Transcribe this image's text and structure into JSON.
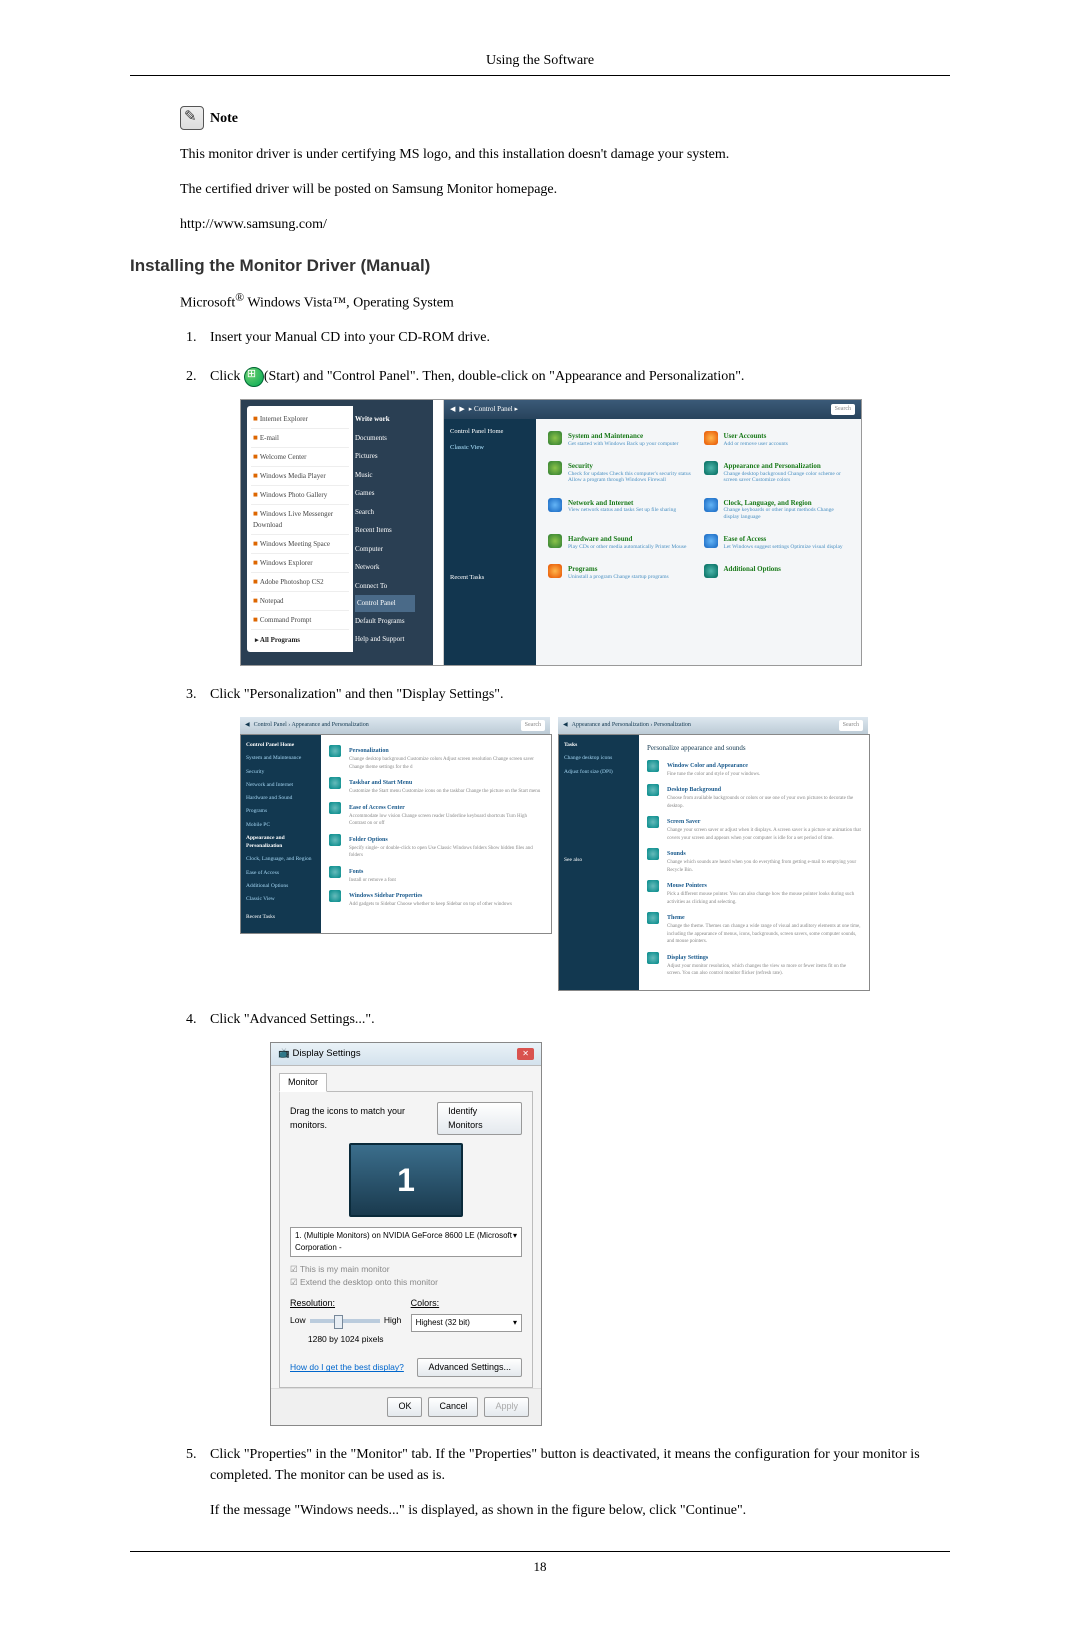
{
  "header": {
    "title": "Using the Software"
  },
  "note": {
    "label": "Note",
    "line1": "This monitor driver is under certifying MS logo, and this installation doesn't damage your system.",
    "line2": "The certified driver will be posted on Samsung Monitor homepage.",
    "line3": "http://www.samsung.com/"
  },
  "section_title": "Installing the Monitor Driver (Manual)",
  "os_line_prefix": "Microsoft",
  "os_line_rest": " Windows Vista™, Operating System",
  "steps": {
    "s1": "Insert your Manual CD into your CD-ROM drive.",
    "s2a": "Click ",
    "s2b": "(Start) and \"Control Panel\". Then, double-click on \"Appearance and Personalization\".",
    "s3": "Click \"Personalization\" and then \"Display Settings\".",
    "s4": "Click \"Advanced Settings...\".",
    "s5": "Click \"Properties\" in the \"Monitor\" tab. If the \"Properties\" button is deactivated, it means the configuration for your monitor is completed. The monitor can be used as is.",
    "s5b": "If the message \"Windows needs...\" is displayed, as shown in the figure below, click \"Continue\"."
  },
  "start_menu": {
    "items": [
      "Internet Explorer",
      "E-mail",
      "Welcome Center",
      "Windows Media Player",
      "Windows Photo Gallery",
      "Windows Live Messenger Download",
      "Windows Meeting Space",
      "Windows Explorer",
      "Adobe Photoshop CS2",
      "Notepad",
      "Command Prompt"
    ],
    "right": [
      "Documents",
      "Pictures",
      "Music",
      "Games",
      "Search",
      "Recent Items",
      "Computer",
      "Network",
      "Connect To",
      "Control Panel",
      "Default Programs",
      "Help and Support"
    ],
    "all_programs": "All Programs",
    "right_top": "Write work"
  },
  "control_panel": {
    "crumb": "Control Panel",
    "search": "Search",
    "left": [
      "Control Panel Home",
      "Classic View"
    ],
    "left_recent": "Recent Tasks",
    "cats": [
      {
        "main": "System and Maintenance",
        "sub": "Get started with Windows\nBack up your computer"
      },
      {
        "main": "User Accounts",
        "sub": "Add or remove user accounts"
      },
      {
        "main": "Security",
        "sub": "Check for updates\nCheck this computer's security status\nAllow a program through Windows Firewall"
      },
      {
        "main": "Appearance and Personalization",
        "sub": "Change desktop background\nChange color scheme or screen saver\nCustomize colors"
      },
      {
        "main": "Network and Internet",
        "sub": "View network status and tasks\nSet up file sharing"
      },
      {
        "main": "Clock, Language, and Region",
        "sub": "Change keyboards or other input methods\nChange display language"
      },
      {
        "main": "Hardware and Sound",
        "sub": "Play CDs or other media automatically\nPrinter\nMouse"
      },
      {
        "main": "Ease of Access",
        "sub": "Let Windows suggest settings\nOptimize visual display"
      },
      {
        "main": "Programs",
        "sub": "Uninstall a program\nChange startup programs"
      },
      {
        "main": "Additional Options",
        "sub": ""
      }
    ]
  },
  "appearance_panel": {
    "crumb_left": "Control Panel › Appearance and Personalization",
    "left_items": [
      "Control Panel Home",
      "System and Maintenance",
      "Security",
      "Network and Internet",
      "Hardware and Sound",
      "Programs",
      "Mobile PC",
      "Appearance and Personalization",
      "Clock, Language, and Region",
      "Ease of Access",
      "Additional Options",
      "Classic View"
    ],
    "rows": [
      {
        "m": "Personalization",
        "s": "Change desktop background   Customize colors   Adjust screen resolution\nChange screen saver  Change theme settings for the d"
      },
      {
        "m": "Taskbar and Start Menu",
        "s": "Customize the Start menu   Customize icons on the taskbar\nChange the picture on the Start menu"
      },
      {
        "m": "Ease of Access Center",
        "s": "Accommodate low vision   Change screen reader\nUnderline keyboard shortcuts   Turn High Contrast on or off"
      },
      {
        "m": "Folder Options",
        "s": "Specify single- or double-click to open   Use Classic Windows folders\nShow hidden files and folders"
      },
      {
        "m": "Fonts",
        "s": "Install or remove a font"
      },
      {
        "m": "Windows Sidebar Properties",
        "s": "Add gadgets to Sidebar   Choose whether to keep Sidebar on top of other windows"
      }
    ],
    "recent": "Recent Tasks"
  },
  "personalization_panel": {
    "crumb": "Appearance and Personalization › Personalization",
    "tasks_label": "Tasks",
    "left_items": [
      "Change desktop icons",
      "Adjust font size (DPI)"
    ],
    "heading": "Personalize appearance and sounds",
    "rows": [
      {
        "m": "Window Color and Appearance",
        "s": "Fine tune the color and style of your windows."
      },
      {
        "m": "Desktop Background",
        "s": "Choose from available backgrounds or colors or use one of your own pictures to decorate the desktop."
      },
      {
        "m": "Screen Saver",
        "s": "Change your screen saver or adjust when it displays. A screen saver is a picture or animation that covers your screen and appears when your computer is idle for a set period of time."
      },
      {
        "m": "Sounds",
        "s": "Change which sounds are heard when you do everything from getting e-mail to emptying your Recycle Bin."
      },
      {
        "m": "Mouse Pointers",
        "s": "Pick a different mouse pointer. You can also change how the mouse pointer looks during such activities as clicking and selecting."
      },
      {
        "m": "Theme",
        "s": "Change the theme. Themes can change a wide range of visual and auditory elements at one time, including the appearance of menus, icons, backgrounds, screen savers, some computer sounds, and mouse pointers."
      },
      {
        "m": "Display Settings",
        "s": "Adjust your monitor resolution, which changes the view so more or fewer items fit on the screen. You can also control monitor flicker (refresh rate)."
      }
    ],
    "see_also": "See also"
  },
  "display_settings": {
    "title": "Display Settings",
    "tab": "Monitor",
    "drag_text": "Drag the icons to match your monitors.",
    "identify": "Identify Monitors",
    "monitor_num": "1",
    "combo": "1. (Multiple Monitors) on NVIDIA GeForce 8600 LE (Microsoft Corporation -",
    "chk1": "This is my main monitor",
    "chk2": "Extend the desktop onto this monitor",
    "resolution_label": "Resolution:",
    "low": "Low",
    "high": "High",
    "res_value": "1280 by 1024 pixels",
    "colors_label": "Colors:",
    "colors_value": "Highest (32 bit)",
    "help_link": "How do I get the best display?",
    "advanced": "Advanced Settings...",
    "ok": "OK",
    "cancel": "Cancel",
    "apply": "Apply"
  },
  "page_number": "18"
}
